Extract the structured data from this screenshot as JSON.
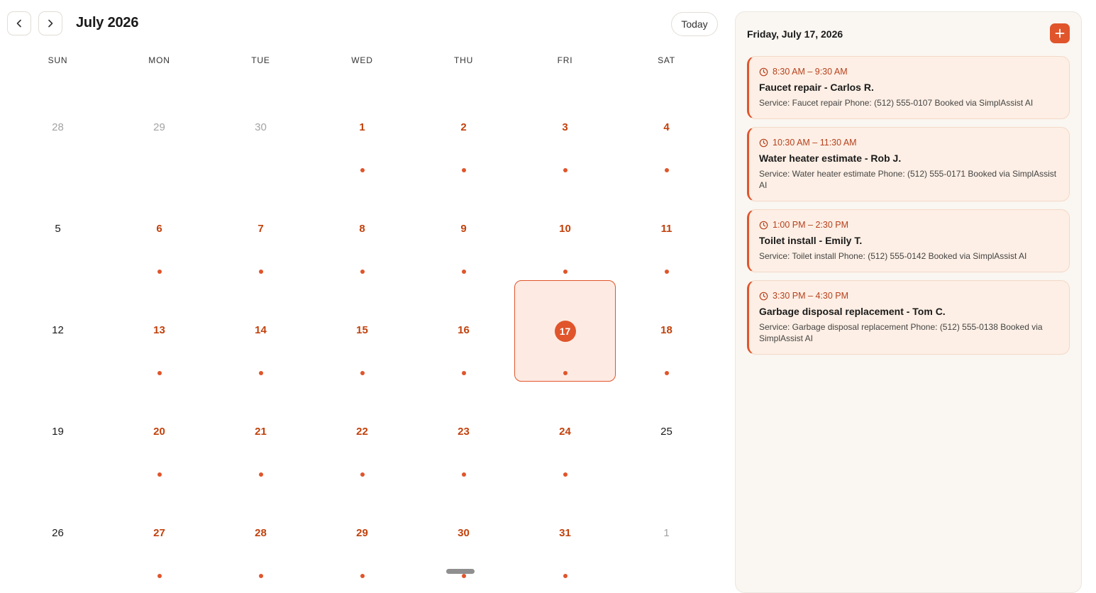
{
  "header": {
    "month_title": "July 2026",
    "today_label": "Today",
    "prev_icon": "chevron-left-icon",
    "next_icon": "chevron-right-icon"
  },
  "weekdays": [
    "SUN",
    "MON",
    "TUE",
    "WED",
    "THU",
    "FRI",
    "SAT"
  ],
  "days": [
    {
      "label": "28",
      "outside": true,
      "has_events": false
    },
    {
      "label": "29",
      "outside": true,
      "has_events": false
    },
    {
      "label": "30",
      "outside": true,
      "has_events": false
    },
    {
      "label": "1",
      "outside": false,
      "has_events": true
    },
    {
      "label": "2",
      "outside": false,
      "has_events": true
    },
    {
      "label": "3",
      "outside": false,
      "has_events": true
    },
    {
      "label": "4",
      "outside": false,
      "has_events": true
    },
    {
      "label": "5",
      "outside": false,
      "has_events": false
    },
    {
      "label": "6",
      "outside": false,
      "has_events": true
    },
    {
      "label": "7",
      "outside": false,
      "has_events": true
    },
    {
      "label": "8",
      "outside": false,
      "has_events": true
    },
    {
      "label": "9",
      "outside": false,
      "has_events": true
    },
    {
      "label": "10",
      "outside": false,
      "has_events": true
    },
    {
      "label": "11",
      "outside": false,
      "has_events": true
    },
    {
      "label": "12",
      "outside": false,
      "has_events": false
    },
    {
      "label": "13",
      "outside": false,
      "has_events": true
    },
    {
      "label": "14",
      "outside": false,
      "has_events": true
    },
    {
      "label": "15",
      "outside": false,
      "has_events": true
    },
    {
      "label": "16",
      "outside": false,
      "has_events": true
    },
    {
      "label": "17",
      "outside": false,
      "has_events": true,
      "selected": true
    },
    {
      "label": "18",
      "outside": false,
      "has_events": true
    },
    {
      "label": "19",
      "outside": false,
      "has_events": false
    },
    {
      "label": "20",
      "outside": false,
      "has_events": true
    },
    {
      "label": "21",
      "outside": false,
      "has_events": true
    },
    {
      "label": "22",
      "outside": false,
      "has_events": true
    },
    {
      "label": "23",
      "outside": false,
      "has_events": true
    },
    {
      "label": "24",
      "outside": false,
      "has_events": true
    },
    {
      "label": "25",
      "outside": false,
      "has_events": false
    },
    {
      "label": "26",
      "outside": false,
      "has_events": false
    },
    {
      "label": "27",
      "outside": false,
      "has_events": true
    },
    {
      "label": "28",
      "outside": false,
      "has_events": true
    },
    {
      "label": "29",
      "outside": false,
      "has_events": true
    },
    {
      "label": "30",
      "outside": false,
      "has_events": true
    },
    {
      "label": "31",
      "outside": false,
      "has_events": true
    },
    {
      "label": "1",
      "outside": true,
      "has_events": false
    }
  ],
  "panel": {
    "date_heading": "Friday, July 17, 2026",
    "add_icon": "plus-icon",
    "events": [
      {
        "time": "8:30 AM – 9:30 AM",
        "title": "Faucet repair - Carlos R.",
        "description": "Service: Faucet repair Phone: (512) 555-0107 Booked via SimplAssist AI"
      },
      {
        "time": "10:30 AM – 11:30 AM",
        "title": "Water heater estimate - Rob J.",
        "description": "Service: Water heater estimate Phone: (512) 555-0171 Booked via SimplAssist AI"
      },
      {
        "time": "1:00 PM – 2:30 PM",
        "title": "Toilet install - Emily T.",
        "description": "Service: Toilet install Phone: (512) 555-0142 Booked via SimplAssist AI"
      },
      {
        "time": "3:30 PM – 4:30 PM",
        "title": "Garbage disposal replacement - Tom C.",
        "description": "Service: Garbage disposal replacement Phone: (512) 555-0138 Booked via SimplAssist AI"
      }
    ]
  },
  "colors": {
    "accent": "#e0552b",
    "accent_text": "#c2410c",
    "selected_bg": "#fdebe3",
    "panel_bg": "#faf6f1",
    "event_bg": "#fdefe5"
  }
}
